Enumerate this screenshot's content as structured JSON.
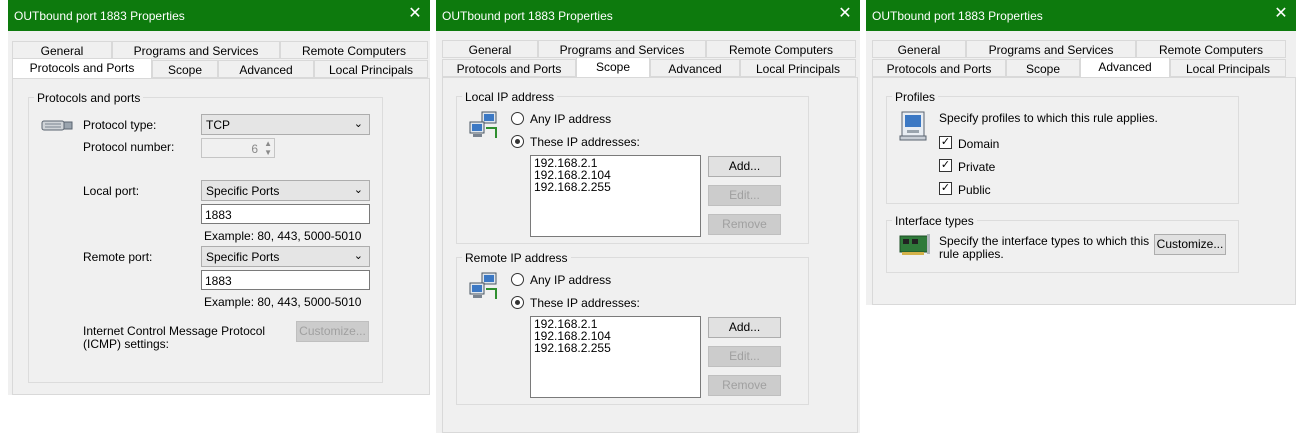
{
  "window_title": "OUTbound port 1883 Properties",
  "close_glyph": "✕",
  "tabs_row1": [
    "General",
    "Programs and Services",
    "Remote Computers"
  ],
  "tabs_row2": [
    "Protocols and Ports",
    "Scope",
    "Advanced",
    "Local Principals"
  ],
  "protocols": {
    "group_title": "Protocols and ports",
    "protocol_type_label": "Protocol type:",
    "protocol_type_value": "TCP",
    "protocol_number_label": "Protocol number:",
    "protocol_number_value": "6",
    "local_port_label": "Local port:",
    "local_port_mode": "Specific Ports",
    "local_port_value": "1883",
    "local_example": "Example: 80, 443, 5000-5010",
    "remote_port_label": "Remote port:",
    "remote_port_mode": "Specific Ports",
    "remote_port_value": "1883",
    "remote_example": "Example: 80, 443, 5000-5010",
    "icmp_label_line1": "Internet Control Message Protocol",
    "icmp_label_line2": "(ICMP) settings:",
    "customize_label": "Customize..."
  },
  "scope": {
    "local_group_title": "Local IP address",
    "remote_group_title": "Remote IP address",
    "any_ip_label": "Any IP address",
    "these_ip_label": "These IP addresses:",
    "local_addresses": [
      "192.168.2.1",
      "192.168.2.104",
      "192.168.2.255"
    ],
    "remote_addresses": [
      "192.168.2.1",
      "192.168.2.104",
      "192.168.2.255"
    ],
    "add_label": "Add...",
    "edit_label": "Edit...",
    "remove_label": "Remove"
  },
  "advanced": {
    "profiles_title": "Profiles",
    "profiles_desc": "Specify profiles to which this rule applies.",
    "profile_domain": "Domain",
    "profile_private": "Private",
    "profile_public": "Public",
    "check_glyph": "✓",
    "interface_title": "Interface types",
    "interface_desc_line1": "Specify the interface types to which this",
    "interface_desc_line2": "rule applies.",
    "customize_label": "Customize..."
  },
  "colors": {
    "title_bar": "#0d7a0d",
    "dialog_bg": "#f0f0f0"
  }
}
